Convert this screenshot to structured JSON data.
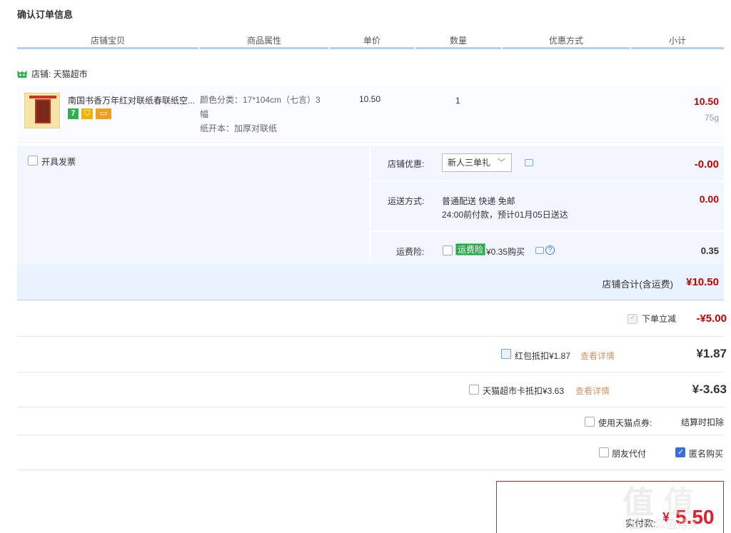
{
  "page": {
    "title": "确认订单信息"
  },
  "columns": [
    "店铺宝贝",
    "商品属性",
    "单价",
    "数量",
    "优惠方式",
    "小计"
  ],
  "shop": {
    "label": "店铺: 天猫超市"
  },
  "item": {
    "name": "南国书香万年红对联纸春联纸空...",
    "badge_7": "7",
    "attr_line1": "颜色分类：17*104cm（七言）3",
    "attr_line2": "幅",
    "attr_line3": "纸开本：加厚对联纸",
    "price": "10.50",
    "qty": "1",
    "subtotal": "10.50",
    "weight": "75g"
  },
  "invoice": {
    "label": "开具发票"
  },
  "shop_discount": {
    "label": "店铺优惠:",
    "selected": "新人三单礼",
    "amount": "-0.00"
  },
  "shipping": {
    "label": "运送方式:",
    "method": "普通配送 快递 免邮",
    "eta": "24:00前付款，预计01月05日送达",
    "amount": "0.00"
  },
  "insurance": {
    "label": "运费险:",
    "tag": "运费险",
    "price": "¥0.35购买",
    "amount": "0.35"
  },
  "shop_total": {
    "label": "店铺合计(含运费)",
    "amount": "¥10.50"
  },
  "order_discount": {
    "label": "下单立减",
    "amount": "-¥5.00"
  },
  "redpacket": {
    "label": "红包抵扣¥1.87",
    "link": "查看详情",
    "amount": "¥1.87"
  },
  "marketcard": {
    "label": "天猫超市卡抵扣¥3.63",
    "link": "查看详情",
    "amount": "¥-3.63"
  },
  "points": {
    "label": "使用天猫点券:",
    "value": "结算时扣除"
  },
  "friend_pay": {
    "label": "朋友代付"
  },
  "anonymous": {
    "label": "匿名购买"
  },
  "payment": {
    "label": "实付款:",
    "currency": "¥",
    "amount": "5.50"
  },
  "watermark": {
    "text": "值 什么值得买"
  },
  "colors": {
    "accent_red": "#c40000",
    "header_line": "#b2d1ff",
    "panel_bg": "#f2f7ff",
    "checkbox_blue": "#3a6fd8",
    "tag_green": "#2aa748"
  }
}
